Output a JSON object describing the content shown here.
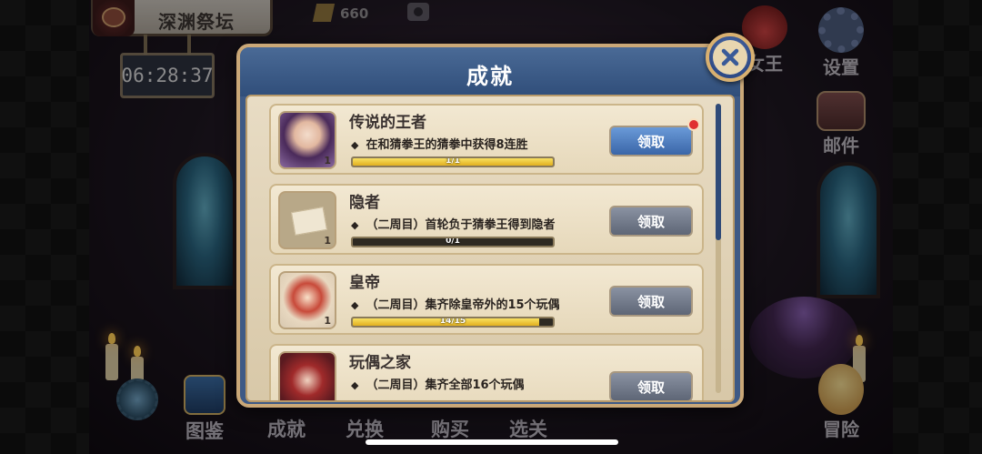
{
  "hud": {
    "location": "深渊祭坛",
    "timer": "06:28:37",
    "currency": "660"
  },
  "side_menu": {
    "queen_label": "女王",
    "settings_label": "设置",
    "mail_label": "邮件",
    "adventure_label": "冒险"
  },
  "bottom_nav": {
    "book_label": "图鉴",
    "achievement_label": "成就",
    "exchange_label": "兑换",
    "buy_label": "购买",
    "select_label": "选关"
  },
  "modal": {
    "title": "成就",
    "achievements": [
      {
        "title": "传说的王者",
        "description": "在和猜拳王的猜拳中获得8连胜",
        "progress_text": "1/1",
        "progress": 1.0,
        "count": "1",
        "button": "领取",
        "claimable": true
      },
      {
        "title": "隐者",
        "description": "（二周目）首轮负于猜拳王得到隐者",
        "progress_text": "0/1",
        "progress": 0.0,
        "count": "1",
        "button": "领取",
        "claimable": false
      },
      {
        "title": "皇帝",
        "description": "（二周目）集齐除皇帝外的15个玩偶",
        "progress_text": "14/15",
        "progress": 0.933,
        "count": "1",
        "button": "领取",
        "claimable": false
      },
      {
        "title": "玩偶之家",
        "description": "（二周目）集齐全部16个玩偶",
        "progress_text": "",
        "progress": 0.0,
        "count": "",
        "button": "领取",
        "claimable": false
      }
    ]
  },
  "colors": {
    "modal_header": "#3e5a86",
    "claim_active": "#4a7ac0",
    "claim_inactive": "#6e7686",
    "progress_fill": "#f0c830"
  }
}
